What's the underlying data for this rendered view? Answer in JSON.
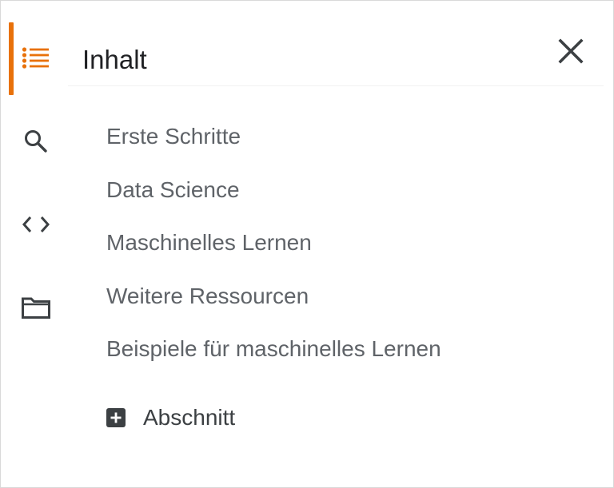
{
  "panel": {
    "title": "Inhalt",
    "close_icon": "close-icon"
  },
  "rail": {
    "items": [
      {
        "name": "toc",
        "icon": "toc-list-icon",
        "active": true
      },
      {
        "name": "search",
        "icon": "search-icon",
        "active": false
      },
      {
        "name": "code-snippets",
        "icon": "code-icon",
        "active": false
      },
      {
        "name": "files",
        "icon": "folder-icon",
        "active": false
      }
    ]
  },
  "toc": {
    "items": [
      "Erste Schritte",
      "Data Science",
      "Maschinelles Lernen",
      "Weitere Ressourcen",
      "Beispiele für maschinelles Lernen"
    ]
  },
  "add_section": {
    "label": "Abschnitt",
    "icon": "add-box-icon"
  },
  "colors": {
    "accent": "#e8710a",
    "icon": "#3c4043",
    "text_primary": "#202124",
    "text_secondary": "#5f6368"
  }
}
